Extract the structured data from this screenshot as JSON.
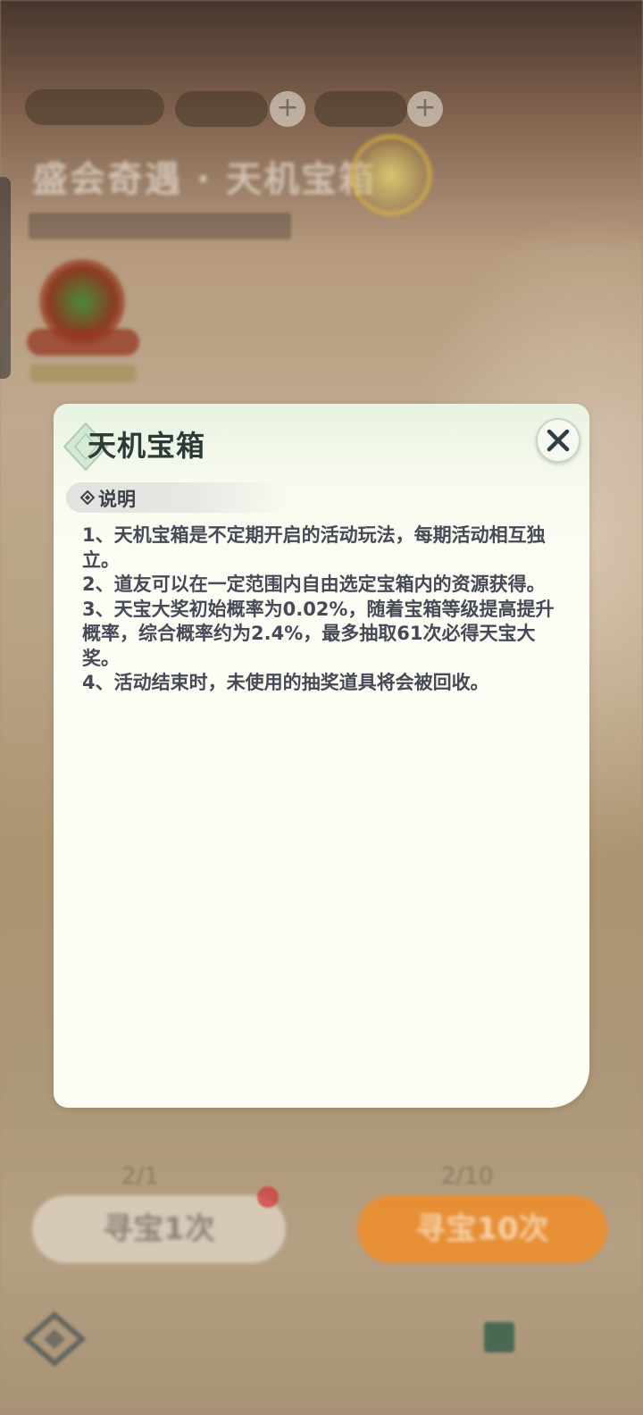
{
  "dialog": {
    "title": "天机宝箱",
    "section_label": "说明",
    "rules": [
      "1、天机宝箱是不定期开启的活动玩法，每期活动相互独立。",
      "2、道友可以在一定范围内自由选定宝箱内的资源获得。",
      "3、天宝大奖初始概率为0.02%，随着宝箱等级提高提升概率，综合概率约为2.4%，最多抽取61次必得天宝大奖。",
      "4、活动结束时，未使用的抽奖道具将会被回收。"
    ],
    "close_icon": "close-icon"
  },
  "background": {
    "title": "盛会奇遇 · 天机宝箱",
    "counter_left": "2/1",
    "counter_right": "2/10",
    "button_one_label": "寻宝1次",
    "button_ten_label": "寻宝10次",
    "colors": {
      "accent_orange": "#f08c28",
      "dialog_bg": "#fdfdf6",
      "text": "#454a56"
    }
  }
}
